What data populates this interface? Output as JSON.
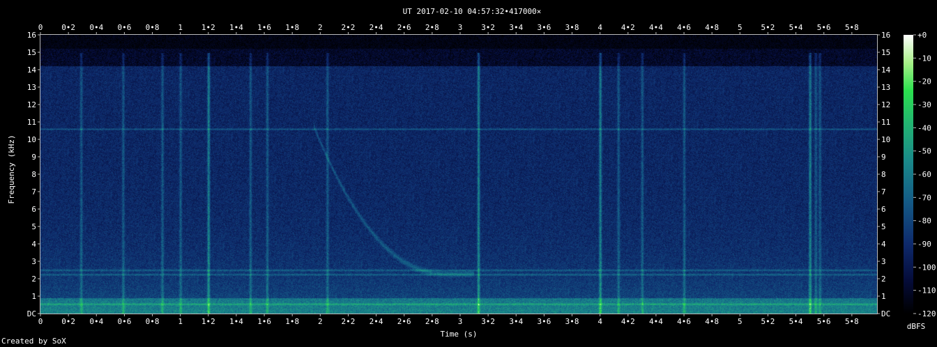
{
  "chart_data": {
    "type": "heatmap",
    "title": "UT 2017-02-10 04:57:32•417000×",
    "xlabel": "Time (s)",
    "ylabel": "Frequency (kHz)",
    "xlim": [
      0,
      5.98
    ],
    "ylim": [
      0,
      16
    ],
    "x_ticks": [
      "0",
      "0•2",
      "0•4",
      "0•6",
      "0•8",
      "1",
      "1•2",
      "1•4",
      "1•6",
      "1•8",
      "2",
      "2•2",
      "2•4",
      "2•6",
      "2•8",
      "3",
      "3•2",
      "3•4",
      "3•6",
      "3•8",
      "4",
      "4•2",
      "4•4",
      "4•6",
      "4•8",
      "5",
      "5•2",
      "5•4",
      "5•6",
      "5•8"
    ],
    "x_tick_values": [
      0,
      0.2,
      0.4,
      0.6,
      0.8,
      1,
      1.2,
      1.4,
      1.6,
      1.8,
      2,
      2.2,
      2.4,
      2.6,
      2.8,
      3,
      3.2,
      3.4,
      3.6,
      3.8,
      4,
      4.2,
      4.4,
      4.6,
      4.8,
      5,
      5.2,
      5.4,
      5.6,
      5.8
    ],
    "y_ticks": [
      "DC",
      "1",
      "2",
      "3",
      "4",
      "5",
      "6",
      "7",
      "8",
      "9",
      "10",
      "11",
      "12",
      "13",
      "14",
      "15",
      "16"
    ],
    "y_tick_values": [
      0,
      1,
      2,
      3,
      4,
      5,
      6,
      7,
      8,
      9,
      10,
      11,
      12,
      13,
      14,
      15,
      16
    ],
    "colorbar": {
      "label": "dBFS",
      "ticks": [
        "+0",
        "-10",
        "-20",
        "-30",
        "-40",
        "-50",
        "-60",
        "-70",
        "-80",
        "-90",
        "-100",
        "-110",
        "-120"
      ],
      "tick_values": [
        0,
        -10,
        -20,
        -30,
        -40,
        -50,
        -60,
        -70,
        -80,
        -90,
        -100,
        -110,
        -120
      ],
      "range": [
        -120,
        0
      ]
    },
    "features": {
      "tone_lines_khz": [
        10.6,
        2.5,
        2.25,
        0.55
      ],
      "impulses_s": [
        0.29,
        0.59,
        0.87,
        1.0,
        1.2,
        1.5,
        1.62,
        2.05,
        3.13,
        4.0,
        4.13,
        4.3,
        4.6,
        5.5,
        5.54,
        5.57
      ],
      "strong_impulses_s": [
        1.2,
        3.13,
        4.0,
        5.5
      ],
      "dispersed_whistler": {
        "start_time_s": 1.95,
        "start_freq_khz": 10.8,
        "end_time_s": 2.9,
        "end_freq_khz": 2.3
      }
    },
    "grid": false,
    "legend": "none"
  },
  "footer": {
    "credit": "Created by SoX"
  }
}
